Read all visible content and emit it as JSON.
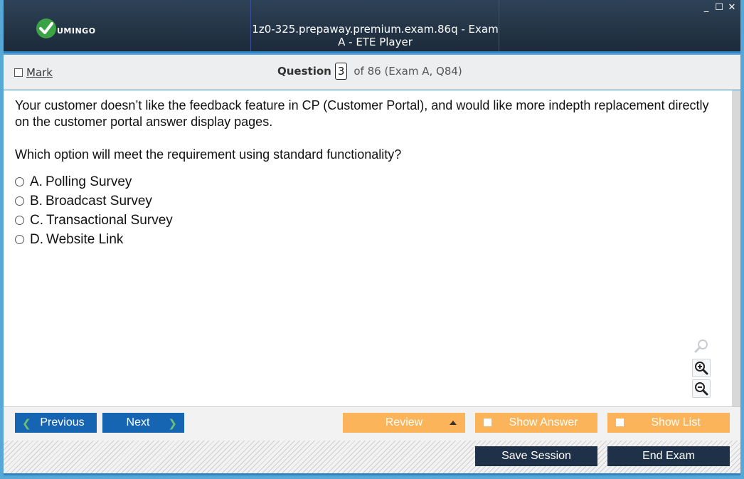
{
  "app": {
    "logo_text": "UMINGO",
    "window_title": "1z0-325.prepaway.premium.exam.86q - Exam A - ETE Player",
    "window_controls": {
      "minimize": "_",
      "maximize": "☐",
      "close": "✕"
    }
  },
  "header": {
    "mark_label": "Mark",
    "question_label": "Question",
    "question_number": "3",
    "question_of": "of 86 (Exam A, Q84)"
  },
  "question": {
    "text_1": "Your customer doesn’t like the feedback feature in CP (Customer Portal), and would like more indepth replacement directly on the customer portal answer display pages.",
    "text_2": "Which option will meet the requirement using standard functionality?",
    "options": [
      {
        "letter": "A.",
        "text": "Polling Survey"
      },
      {
        "letter": "B.",
        "text": "Broadcast Survey"
      },
      {
        "letter": "C.",
        "text": "Transactional Survey"
      },
      {
        "letter": "D.",
        "text": "Website Link"
      }
    ]
  },
  "zoom": {
    "icons": [
      "search-icon",
      "zoom-in-icon",
      "zoom-out-icon"
    ]
  },
  "footer": {
    "previous_label": "Previous",
    "next_label": "Next",
    "review_label": "Review",
    "show_answer_label": "Show Answer",
    "show_list_label": "Show List",
    "save_session_label": "Save Session",
    "end_exam_label": "End Exam"
  },
  "colors": {
    "titlebar": "#1c2a3a",
    "nav_button": "#1665b3",
    "orange_button": "#fbb459",
    "dark_button": "#1e3148",
    "accent_blue": "#2f83c2"
  }
}
